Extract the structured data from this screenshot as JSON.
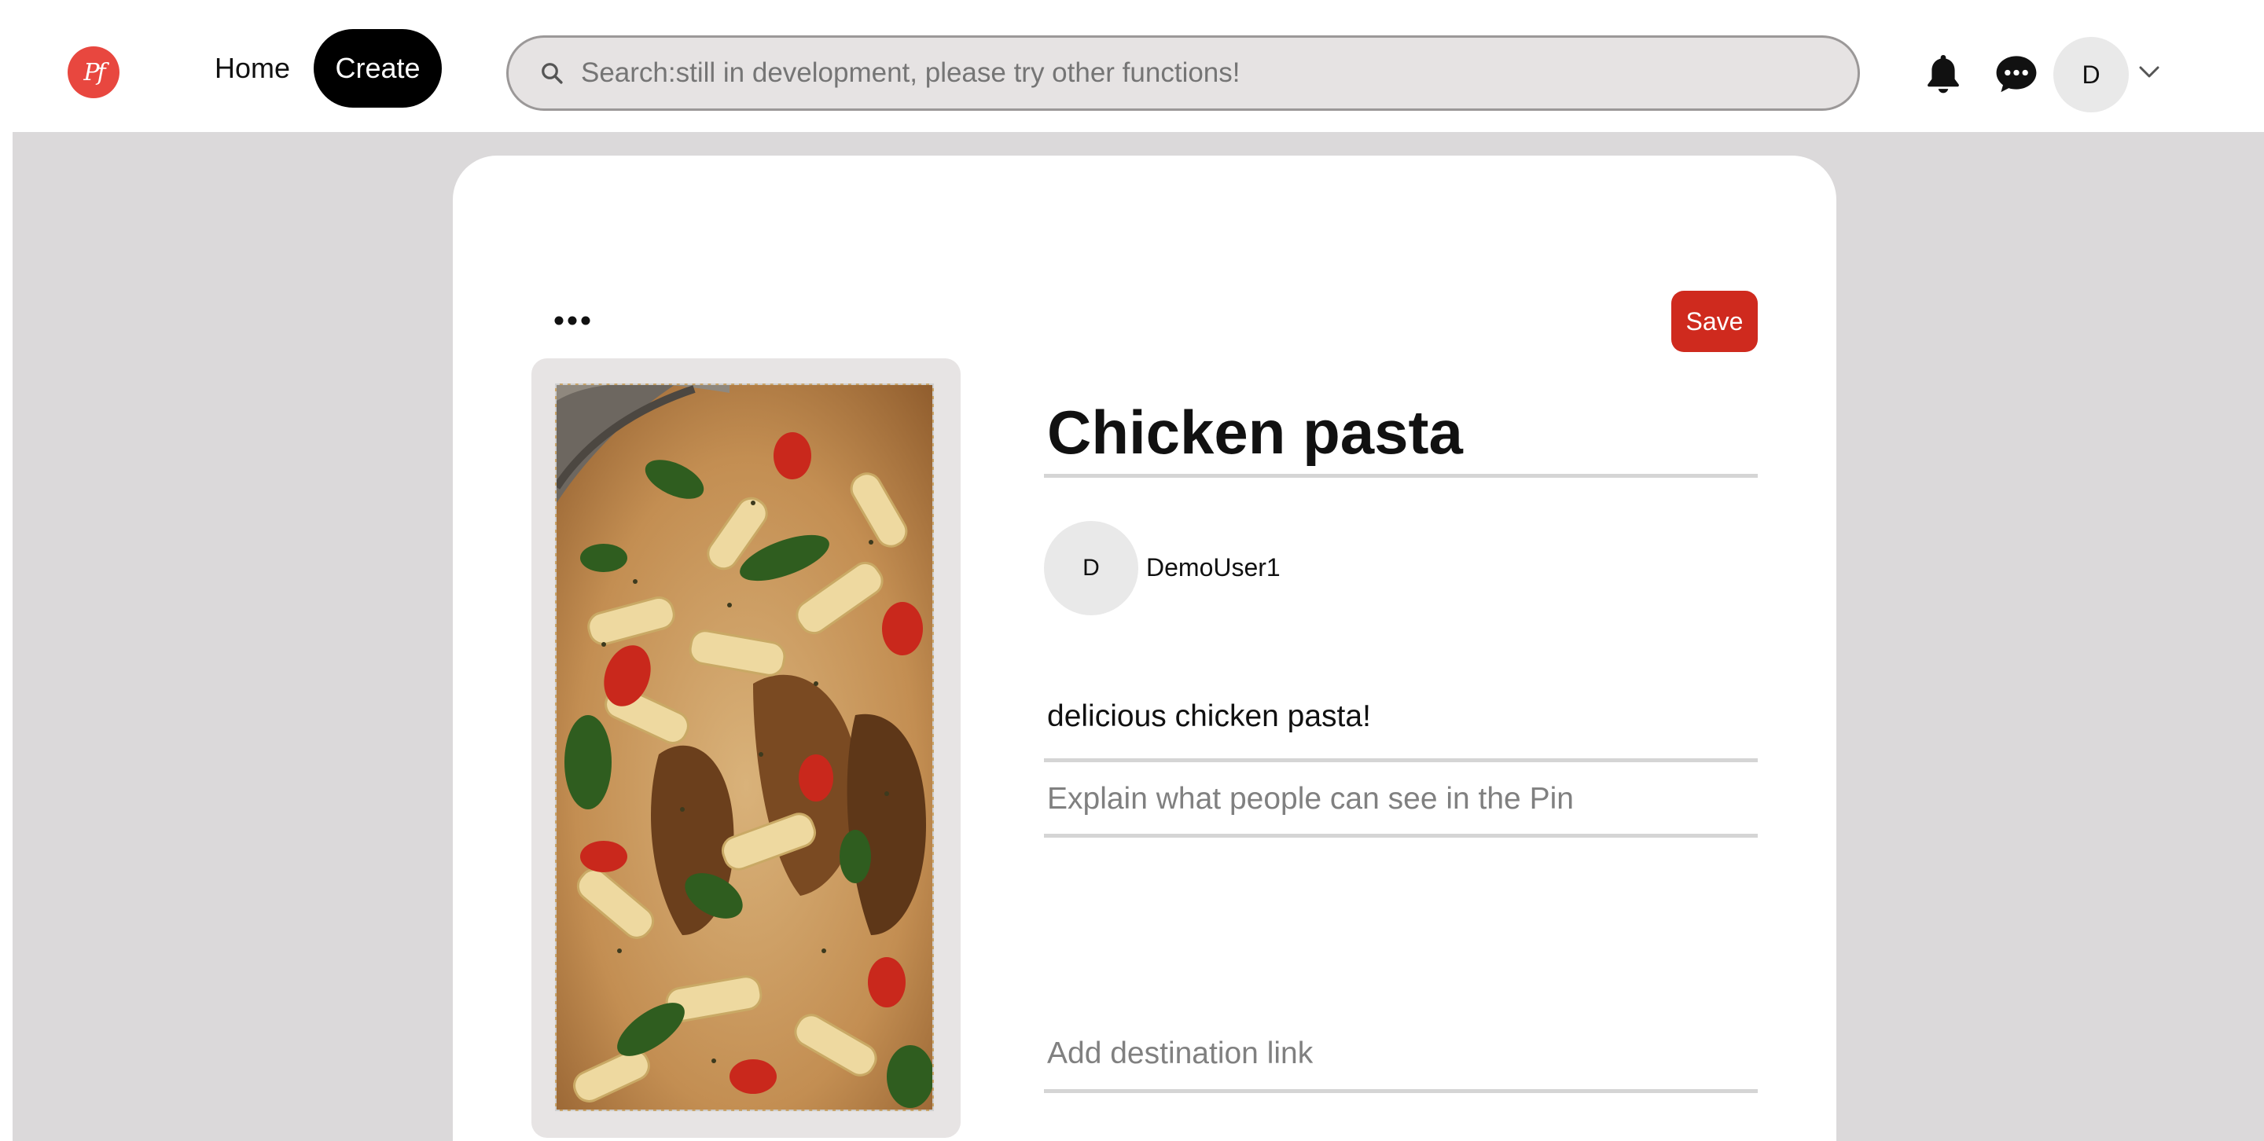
{
  "header": {
    "logo_text": "Pf",
    "nav": {
      "home_label": "Home",
      "create_label": "Create"
    },
    "search": {
      "placeholder": "Search:still in development, please try other functions!",
      "icon": "search-icon"
    },
    "icons": [
      "bell-icon",
      "chat-bubble-icon",
      "chevron-down-icon"
    ],
    "user_avatar_initial": "D"
  },
  "pin": {
    "more_label": "•••",
    "save_label": "Save",
    "title": "Chicken pasta",
    "author": {
      "initial": "D",
      "name": "DemoUser1"
    },
    "description_value": "delicious chicken pasta!",
    "alt_text_placeholder": "Explain what people can see in the Pin",
    "destination_link_placeholder": "Add destination link",
    "image_subject": "chicken pasta dish photo"
  },
  "colors": {
    "brand_red": "#e8473f",
    "save_red": "#cf2a1e",
    "stage_gray": "#dbd9da",
    "create_black": "#000000"
  }
}
